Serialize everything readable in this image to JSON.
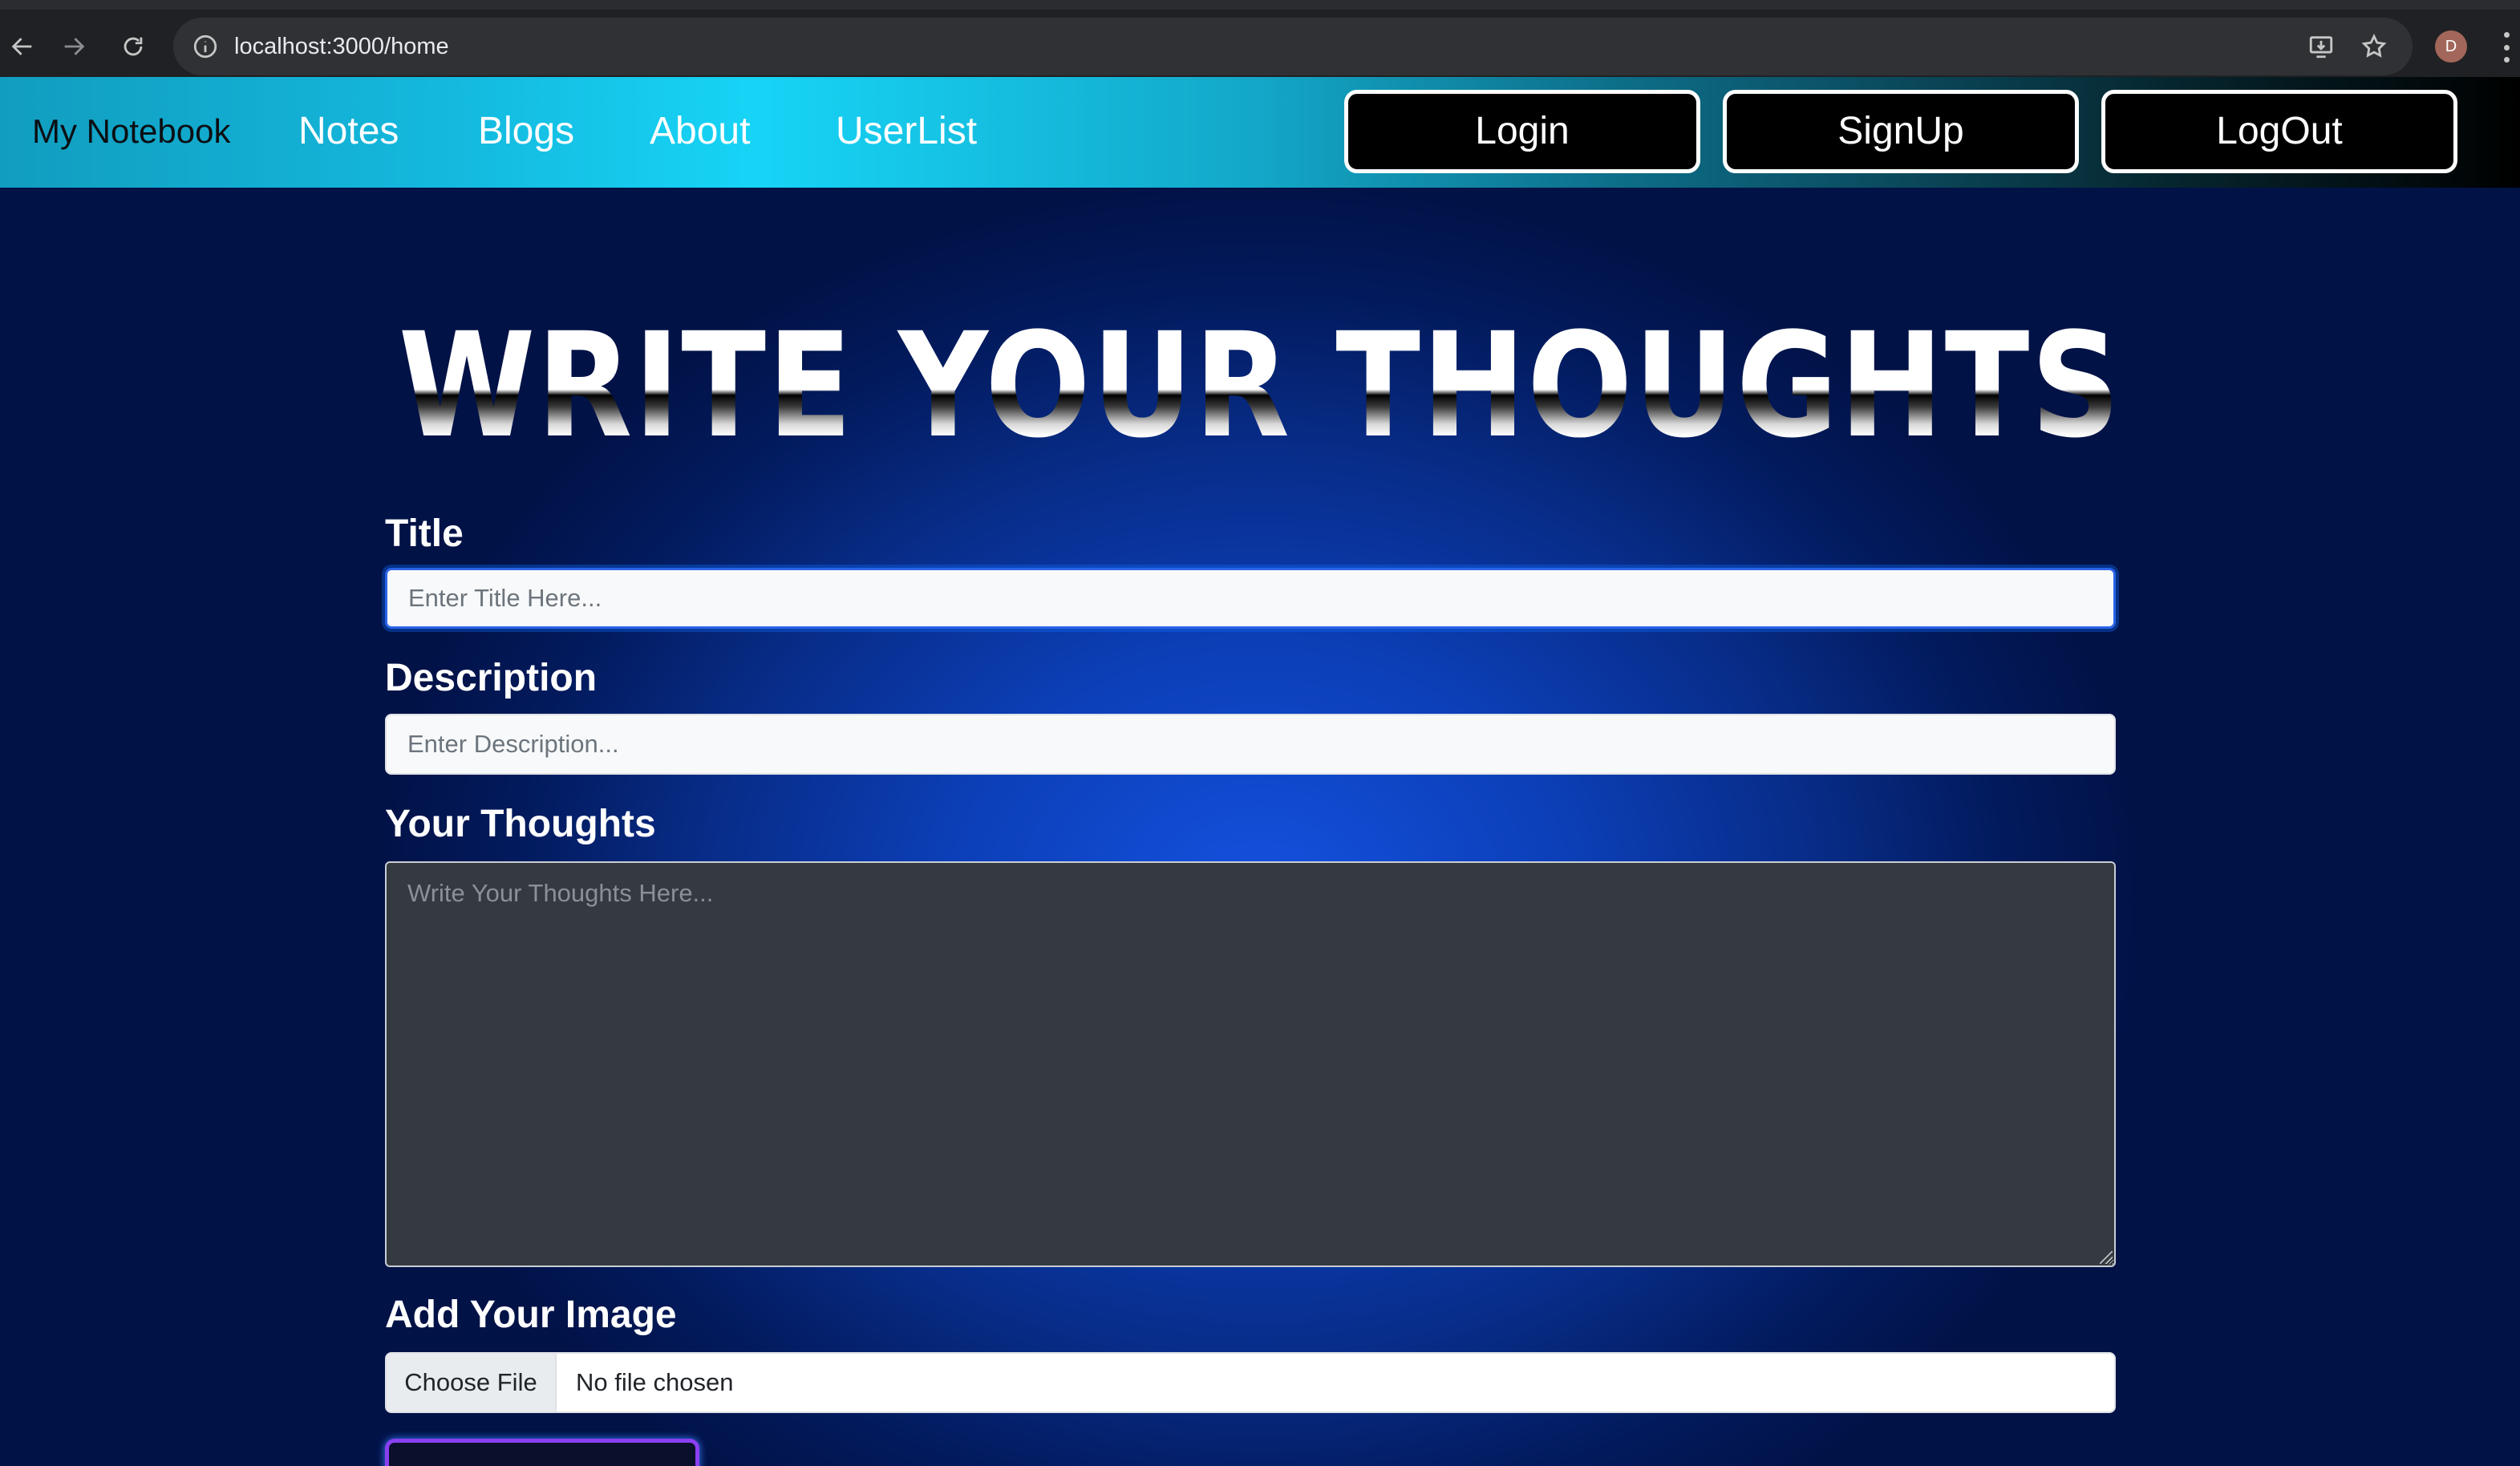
{
  "browser": {
    "url": "localhost:3000/home",
    "profile_initial": "D",
    "icons": [
      "back-arrow-icon",
      "forward-arrow-icon",
      "reload-icon",
      "info-icon",
      "install-app-icon",
      "bookmark-star-icon",
      "kebab-menu-icon"
    ]
  },
  "navbar": {
    "brand": "My Notebook",
    "links": [
      "Notes",
      "Blogs",
      "About",
      "UserList"
    ],
    "buttons": [
      "Login",
      "SignUp",
      "LogOut"
    ]
  },
  "form": {
    "headline": "WRITE YOUR THOUGHTS",
    "title_label": "Title",
    "title_placeholder": "Enter Title Here...",
    "description_label": "Description",
    "description_placeholder": "Enter Description...",
    "thoughts_label": "Your Thoughts",
    "thoughts_placeholder": "Write Your Thoughts Here...",
    "image_label": "Add Your Image",
    "file_button": "Choose File",
    "file_status": "No file chosen"
  },
  "colors": {
    "navbar_accent": "#17d4f6",
    "page_background": "#0c3fb8",
    "button_bg": "#000000",
    "submit_border": "#8a3ff0"
  }
}
